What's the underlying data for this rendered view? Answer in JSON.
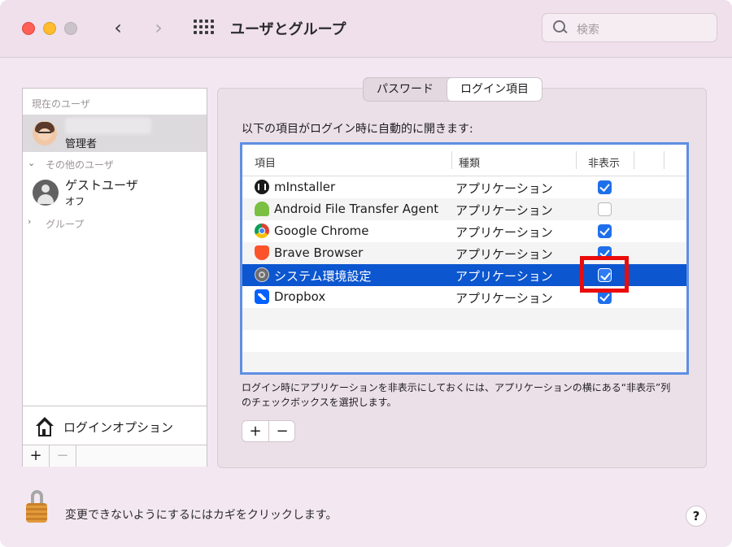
{
  "window": {
    "title": "ユーザとグループ",
    "nav_back": "‹",
    "nav_forward": "›"
  },
  "search": {
    "placeholder": "検索"
  },
  "sidebar": {
    "current_users_header": "現在のユーザ",
    "current_user": {
      "role": "管理者"
    },
    "other_users_header": "その他のユーザ",
    "guest_user": {
      "name": "ゲストユーザ",
      "status": "オフ"
    },
    "groups_header": "グループ",
    "login_options": "ログインオプション",
    "add_label": "+",
    "remove_label": "−"
  },
  "tabs": [
    {
      "label": "パスワード",
      "active": false
    },
    {
      "label": "ログイン項目",
      "active": true
    }
  ],
  "login_items": {
    "heading": "以下の項目がログイン時に自動的に開きます:",
    "columns": {
      "item": "項目",
      "kind": "種類",
      "hide": "非表示"
    },
    "rows": [
      {
        "name": "mInstaller",
        "kind": "アプリケーション",
        "hidden": true,
        "icon": "minstaller-icon"
      },
      {
        "name": "Android File Transfer Agent",
        "kind": "アプリケーション",
        "hidden": false,
        "icon": "android-icon"
      },
      {
        "name": "Google Chrome",
        "kind": "アプリケーション",
        "hidden": true,
        "icon": "chrome-icon"
      },
      {
        "name": "Brave Browser",
        "kind": "アプリケーション",
        "hidden": true,
        "icon": "brave-icon"
      },
      {
        "name": "システム環境設定",
        "kind": "アプリケーション",
        "hidden": true,
        "icon": "system-preferences-icon",
        "selected": true
      },
      {
        "name": "Dropbox",
        "kind": "アプリケーション",
        "hidden": true,
        "icon": "dropbox-icon"
      }
    ],
    "note": "ログイン時にアプリケーションを非表示にしておくには、アプリケーションの横にある“非表示”列のチェックボックスを選択します。",
    "add_label": "+",
    "remove_label": "−"
  },
  "footer": {
    "lock_text": "変更できないようにするにはカギをクリックします。",
    "help_label": "?"
  },
  "colors": {
    "selection": "#0c56cf",
    "checkbox": "#1f6feb",
    "highlight": "#ea0b0b",
    "table_border": "#5e8fe3"
  }
}
